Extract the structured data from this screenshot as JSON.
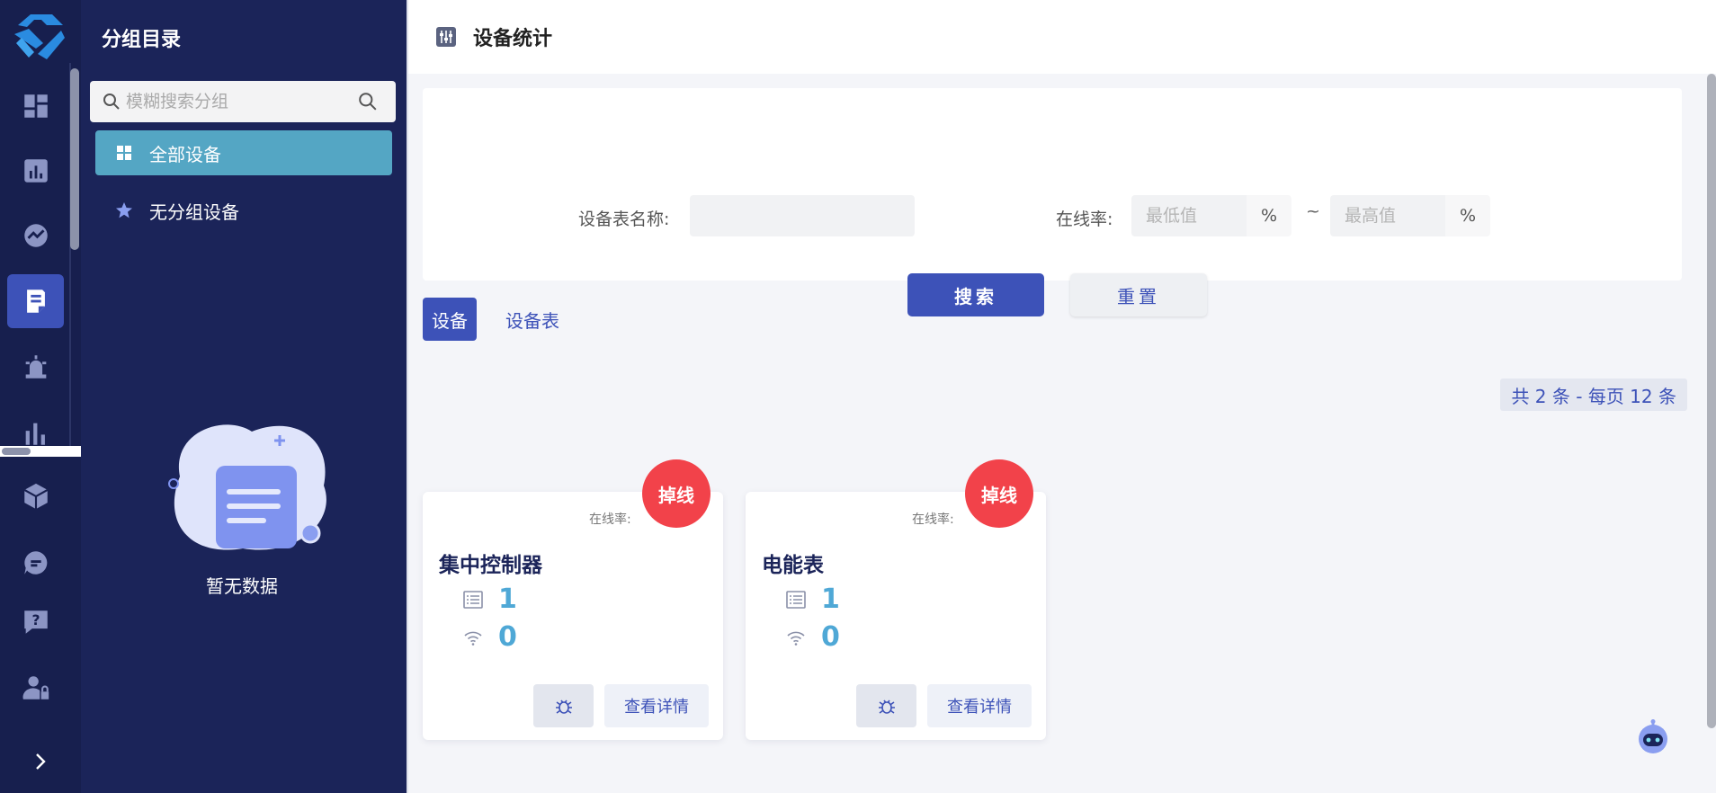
{
  "rail": {
    "items": [
      {
        "name": "dashboard-icon",
        "active": false
      },
      {
        "name": "report-icon",
        "active": false
      },
      {
        "name": "monitor-icon",
        "active": false
      },
      {
        "name": "device-stats-icon",
        "active": true
      },
      {
        "name": "alarm-icon",
        "active": false
      },
      {
        "name": "bar-chart-icon",
        "active": false
      },
      {
        "name": "cube-icon",
        "active": false
      },
      {
        "name": "message-icon",
        "active": false
      },
      {
        "name": "help-icon",
        "active": false
      },
      {
        "name": "user-lock-icon",
        "active": false
      }
    ],
    "expand_icon": "chevron-right-icon"
  },
  "groups": {
    "title": "分组目录",
    "search_placeholder": "模糊搜索分组",
    "items": [
      {
        "label": "全部设备",
        "icon": "grid-icon",
        "active": true
      },
      {
        "label": "无分组设备",
        "icon": "star-icon",
        "active": false
      }
    ],
    "empty_text": "暂无数据"
  },
  "header": {
    "title": "设备统计",
    "icon": "sliders-icon"
  },
  "filter": {
    "name_label": "设备表名称:",
    "name_value": "",
    "rate_label": "在线率:",
    "min_placeholder": "最低值",
    "max_placeholder": "最高值",
    "unit": "%",
    "separator": "~",
    "search_button": "搜索",
    "reset_button": "重置"
  },
  "tabs": [
    {
      "label": "设备",
      "active": true
    },
    {
      "label": "设备表",
      "active": false
    }
  ],
  "pager": {
    "summary": "共 2 条 - 每页 12 条"
  },
  "cards": [
    {
      "name": "集中控制器",
      "status": "掉线",
      "rate_label": "在线率:",
      "rate_value": "",
      "device_count": "1",
      "online_count": "0",
      "detail_button": "查看详情"
    },
    {
      "name": "电能表",
      "status": "掉线",
      "rate_label": "在线率:",
      "rate_value": "",
      "device_count": "1",
      "online_count": "0",
      "detail_button": "查看详情"
    }
  ],
  "colors": {
    "rail_bg": "#171f4e",
    "panel_bg": "#1b2459",
    "primary": "#3d52b8",
    "active_group": "#54a6c4",
    "offline_badge": "#f2424a",
    "stat_value": "#4fa8d6"
  }
}
